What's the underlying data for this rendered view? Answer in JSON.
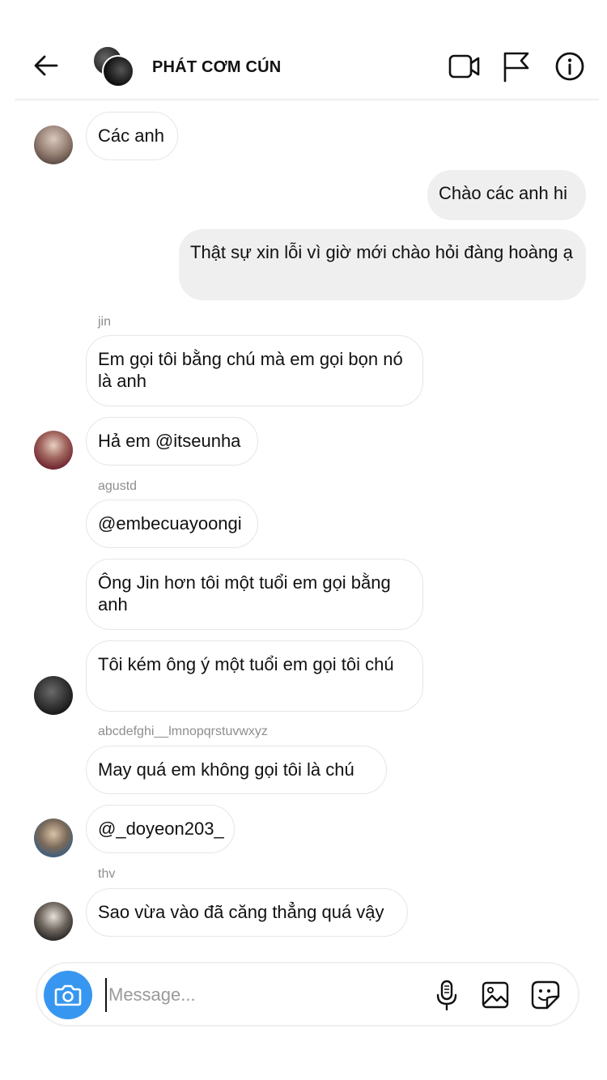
{
  "header": {
    "title": "PHÁT CƠM CÚN",
    "back_icon": "arrow-left-icon",
    "video_icon": "video-camera-icon",
    "flag_icon": "flag-icon",
    "info_icon": "info-icon"
  },
  "messages": [
    {
      "side": "in",
      "text": "Các anh"
    },
    {
      "side": "out",
      "text": "Chào các anh hi"
    },
    {
      "side": "out",
      "text": "Thật sự xin lỗi vì giờ mới chào hỏi đàng hoàng ạ"
    },
    {
      "side": "in",
      "sender": "jin",
      "text": "Em gọi tôi bằng chú mà em gọi bọn nó là anh"
    },
    {
      "side": "in",
      "text": "Hả em @itseunha"
    },
    {
      "side": "in",
      "sender": "agustd",
      "text": "@embecuayoongi"
    },
    {
      "side": "in",
      "text": "Ông Jin hơn tôi một tuổi em gọi bằng anh"
    },
    {
      "side": "in",
      "text": "Tôi kém ông ý một tuổi em gọi tôi chú"
    },
    {
      "side": "in",
      "sender": "abcdefghi__lmnopqrstuvwxyz",
      "text": "May quá em không gọi tôi là chú"
    },
    {
      "side": "in",
      "text": "@_doyeon203_"
    },
    {
      "side": "in",
      "sender": "thv",
      "text": "Sao vừa vào đã căng thẳng quá vậy"
    }
  ],
  "composer": {
    "placeholder": "Message...",
    "value": "",
    "camera_icon": "camera-icon",
    "mic_icon": "microphone-icon",
    "gallery_icon": "image-icon",
    "sticker_icon": "sticker-icon"
  },
  "colors": {
    "accent": "#3797f0",
    "outgoing_bubble": "#efefef",
    "incoming_border": "#e6e6e6",
    "sender_label": "#8e8e8e"
  }
}
